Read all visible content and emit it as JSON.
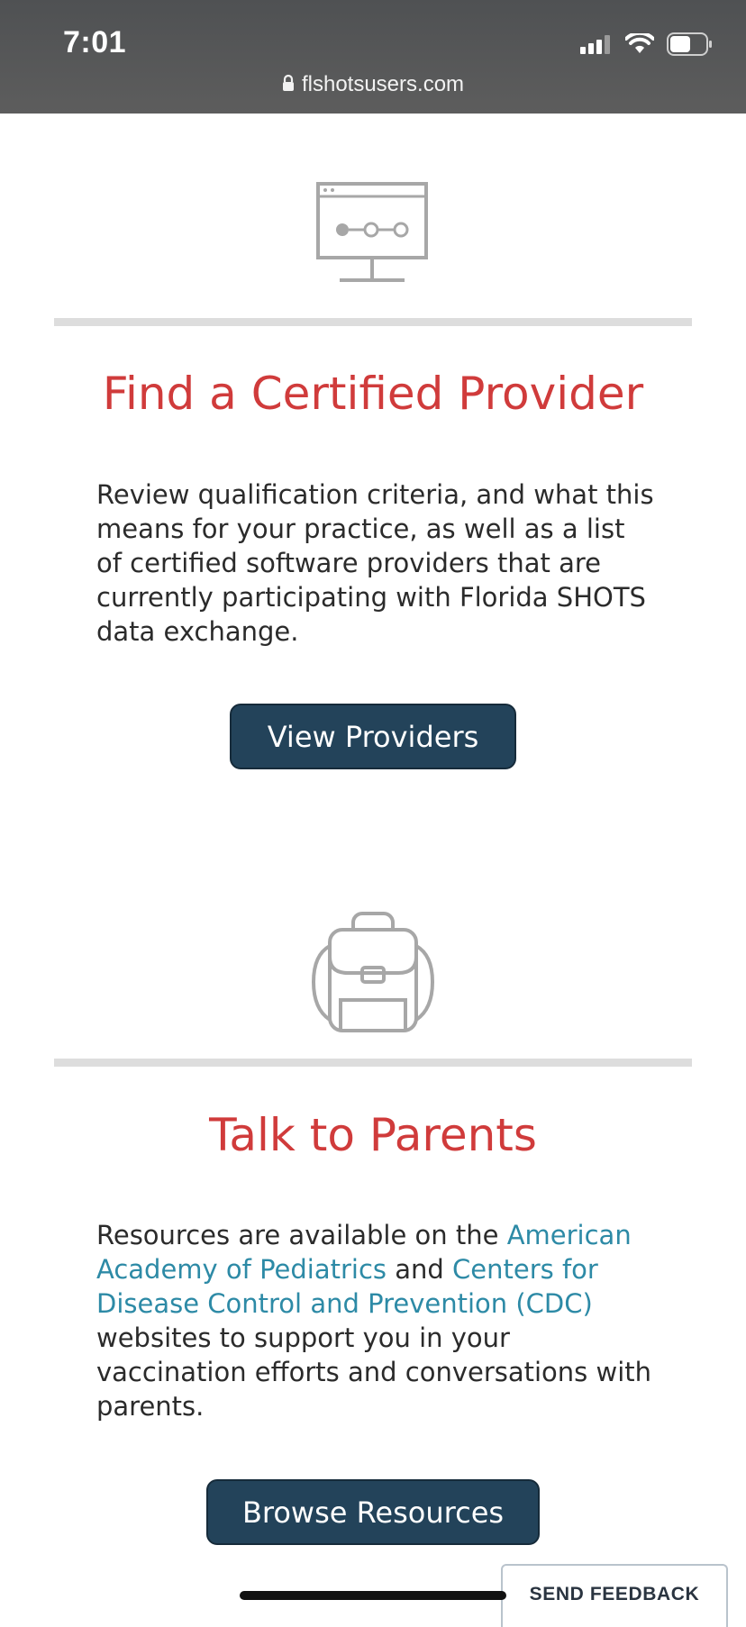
{
  "status_bar": {
    "time": "7:01",
    "url": "flshotsusers.com",
    "icons": [
      "signal-icon",
      "wifi-icon",
      "battery-icon"
    ]
  },
  "sections": [
    {
      "icon": "monitor-icon",
      "heading": "Find a Certified Provider",
      "body": "Review qualification criteria, and what this means for your practice, as well as a list of certified software providers that are currently participating with Florida SHOTS data exchange.",
      "button": "View Providers"
    },
    {
      "icon": "backpack-icon",
      "heading": "Talk to Parents",
      "body_parts": {
        "p1": "Resources are available on the ",
        "link1": "American Academy of Pediatrics",
        "p2": " and ",
        "link2": "Centers for Disease Control and Prevention (CDC)",
        "p3": " websites to support you in your vaccination efforts and conversations with parents."
      },
      "button": "Browse Resources"
    }
  ],
  "feedback": {
    "label": "SEND FEEDBACK"
  },
  "colors": {
    "heading": "#d03b3b",
    "button": "#23435a",
    "link": "#2d8aa6",
    "divider": "#dddddd"
  }
}
